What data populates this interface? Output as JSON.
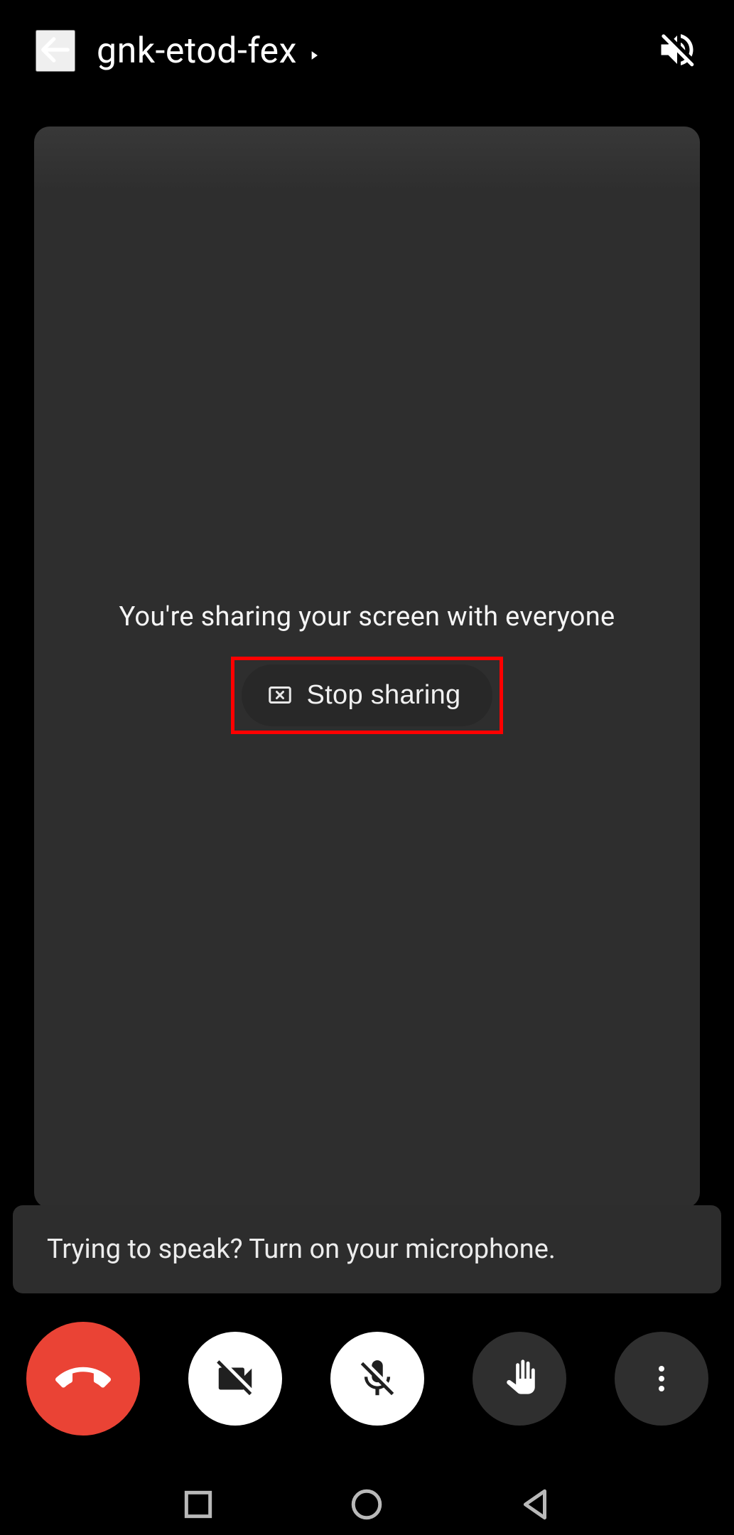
{
  "header": {
    "meeting_code": "gnk-etod-fex"
  },
  "main": {
    "sharing_message": "You're sharing your screen with everyone",
    "stop_sharing_label": "Stop sharing"
  },
  "toast": {
    "mic_hint": "Trying to speak? Turn on your microphone."
  },
  "icons": {
    "back": "arrow-left",
    "chevron": "caret-right",
    "volume_off": "volume-off",
    "stop_presenting": "stop-screen-share",
    "hang_up": "call-end",
    "camera_off": "videocam-off",
    "mic_off": "mic-off",
    "raise_hand": "hand",
    "more": "more-vert",
    "nav_recent": "square",
    "nav_home": "circle",
    "nav_back": "triangle-left"
  },
  "colors": {
    "end_call": "#ea4335",
    "highlight_border": "#ff0000",
    "tile_bg": "#2e2e2e",
    "toast_bg": "#2d2d2d"
  }
}
